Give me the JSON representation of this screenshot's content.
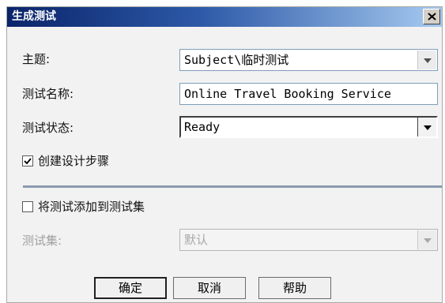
{
  "dialog": {
    "title": "生成测试",
    "close_label": "X"
  },
  "form": {
    "subject": {
      "label": "主题:",
      "value": "Subject\\临时测试"
    },
    "test_name": {
      "label": "测试名称:",
      "value": "Online Travel Booking Service"
    },
    "test_status": {
      "label": "测试状态:",
      "value": "Ready"
    },
    "create_design_steps": {
      "label": "创建设计步骤",
      "checked": true
    },
    "add_to_test_set": {
      "label": "将测试添加到测试集",
      "checked": false
    },
    "test_set": {
      "label": "测试集:",
      "value": "默认",
      "disabled": true
    }
  },
  "buttons": {
    "ok": "确定",
    "cancel": "取消",
    "help": "帮助"
  },
  "colors": {
    "titlebar_start": "#0a246a",
    "titlebar_end": "#a6caf0",
    "dialog_bg": "#f2f2f2",
    "divider": "#8a9bb0"
  }
}
